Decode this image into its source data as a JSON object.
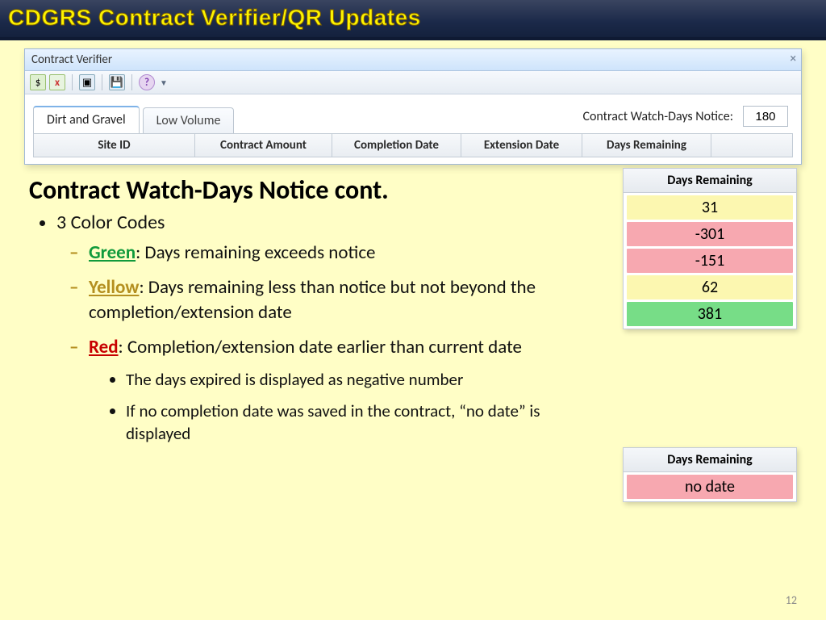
{
  "slide_title": "CDGRS Contract Verifier/QR Updates",
  "window": {
    "title": "Contract Verifier",
    "tabs": [
      "Dirt and Gravel",
      "Low Volume"
    ],
    "notice_label": "Contract Watch-Days Notice:",
    "notice_value": "180",
    "columns": [
      "Site ID",
      "Contract Amount",
      "Completion Date",
      "Extension Date",
      "Days Remaining"
    ]
  },
  "body": {
    "heading": "Contract Watch-Days Notice cont.",
    "bullet1": "3 Color Codes",
    "green_label": "Green",
    "green_text": ": Days remaining exceeds notice",
    "yellow_label": "Yellow",
    "yellow_text": ": Days remaining less than notice but not beyond the completion/extension date",
    "red_label": "Red",
    "red_text": ": Completion/extension date earlier than current date",
    "sub1": "The days expired is displayed as negative number",
    "sub2": "If no completion date was saved in the contract, “no date” is displayed"
  },
  "panel1": {
    "header": "Days Remaining",
    "rows": [
      {
        "value": "31",
        "color": "c-yellow"
      },
      {
        "value": "-301",
        "color": "c-red"
      },
      {
        "value": "-151",
        "color": "c-red"
      },
      {
        "value": "62",
        "color": "c-yellow"
      },
      {
        "value": "381",
        "color": "c-green"
      }
    ]
  },
  "panel2": {
    "header": "Days Remaining",
    "rows": [
      {
        "value": "no date",
        "color": "c-red"
      }
    ]
  },
  "page_number": "12"
}
